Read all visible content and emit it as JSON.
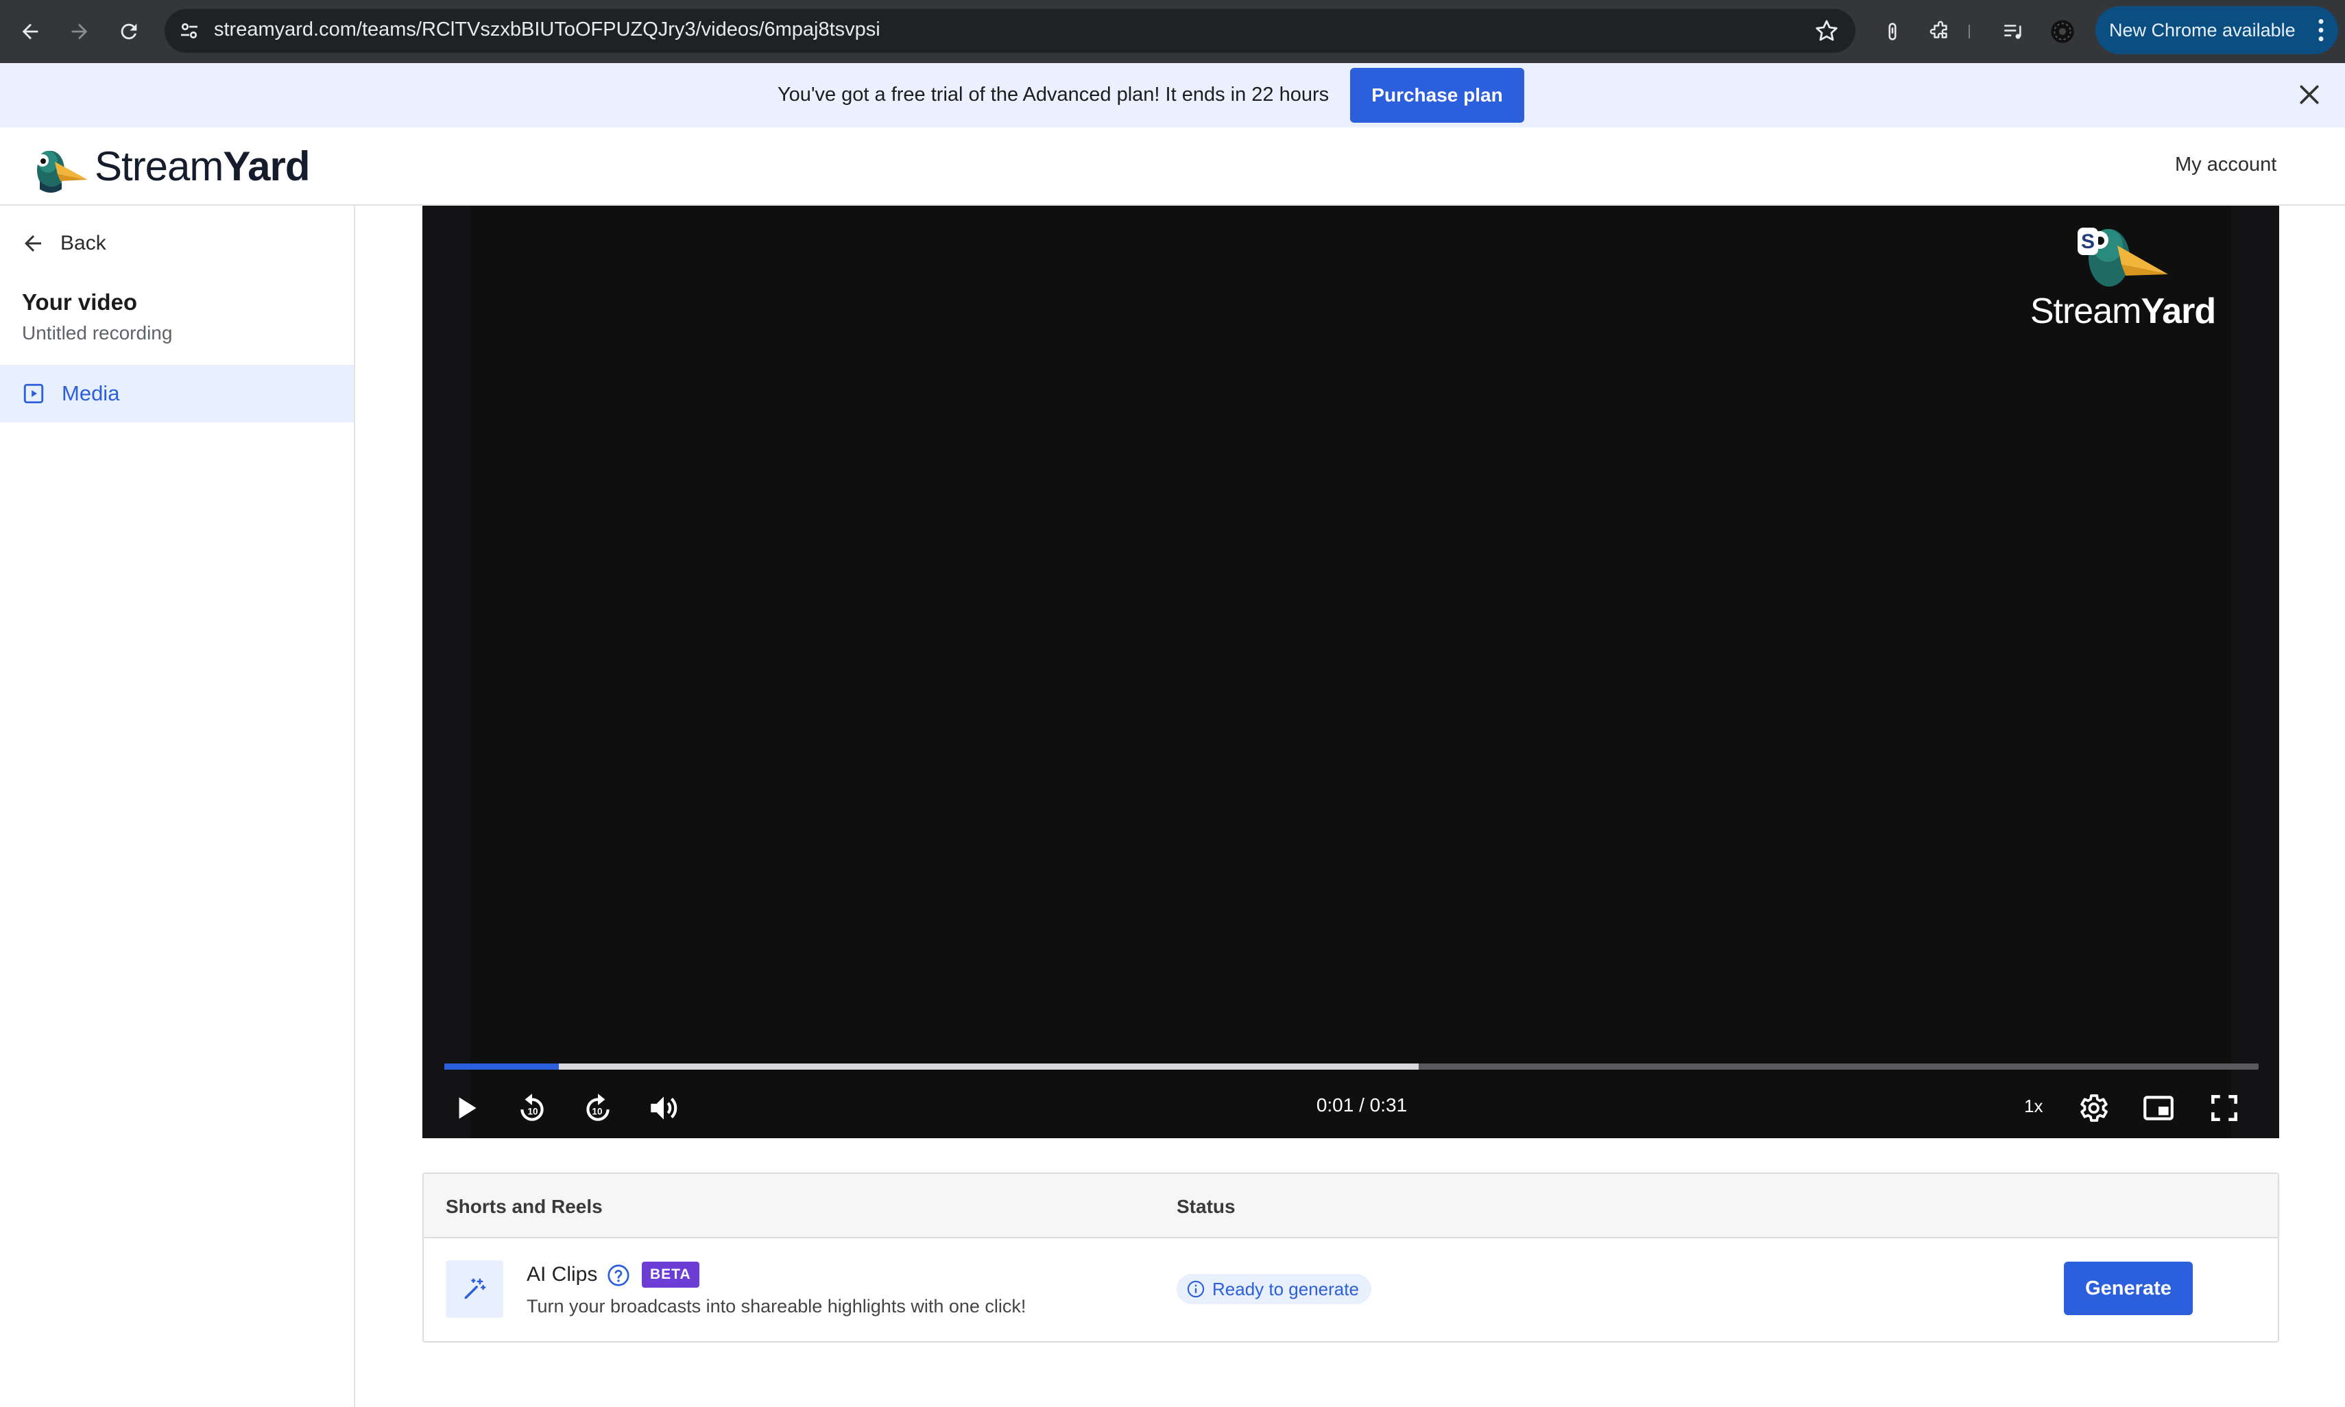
{
  "browser": {
    "url": "streamyard.com/teams/RClTVszxbBIUToOFPUZQJry3/videos/6mpaj8tsvpsi",
    "new_chrome_label": "New Chrome available"
  },
  "banner": {
    "message": "You've got a free trial of the Advanced plan! It ends in 22 hours",
    "purchase_label": "Purchase plan"
  },
  "header": {
    "logo_text_light": "Stream",
    "logo_text_bold": "Yard",
    "my_account_label": "My account"
  },
  "sidebar": {
    "back_label": "Back",
    "section_title": "Your video",
    "video_name": "Untitled recording",
    "items": [
      {
        "label": "Media",
        "icon": "play-square-icon",
        "active": true
      }
    ]
  },
  "player": {
    "watermark_light": "Stream",
    "watermark_bold": "Yard",
    "time_display": "0:01 / 0:31",
    "played_fraction": 0.063,
    "buffered_fraction": 0.537,
    "speed_label": "1x",
    "controls": [
      "play-icon",
      "rewind-10-icon",
      "forward-10-icon",
      "volume-icon",
      "settings-gear-icon",
      "picture-in-picture-icon",
      "fullscreen-icon"
    ]
  },
  "shorts": {
    "col_name_header": "Shorts and Reels",
    "col_status_header": "Status",
    "rows": [
      {
        "title": "AI Clips",
        "badge": "BETA",
        "description": "Turn your broadcasts into shareable highlights with one click!",
        "status": "Ready to generate",
        "action_label": "Generate"
      }
    ]
  },
  "colors": {
    "accent": "#2b5fdb",
    "banner_bg": "#eaf0fd",
    "beta_badge": "#6c3ed6",
    "player_bg": "#0f0f10",
    "chrome_bg": "#35363a"
  }
}
